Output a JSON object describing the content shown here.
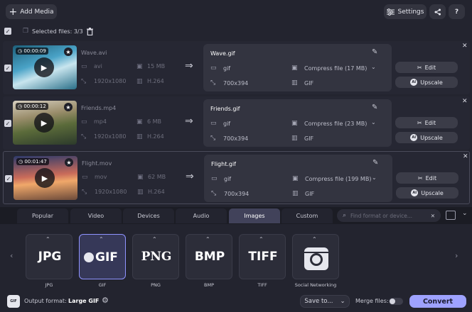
{
  "toolbar": {
    "add_media_label": "Add Media",
    "settings_label": "Settings"
  },
  "selection": {
    "selected_label": "Selected files: 3/3"
  },
  "files": [
    {
      "duration": "00:00:09",
      "name": "Wave.avi",
      "container": "avi",
      "size": "15 MB",
      "resolution": "1920x1080",
      "codec": "H.264",
      "output_name": "Wave.gif",
      "output_format": "gif",
      "compress": "Compress file (17 MB)",
      "output_resolution": "700x394",
      "output_codec": "GIF"
    },
    {
      "duration": "00:00:12",
      "name": "Friends.mp4",
      "container": "mp4",
      "size": "6 MB",
      "resolution": "1920x1080",
      "codec": "H.264",
      "output_name": "Friends.gif",
      "output_format": "gif",
      "compress": "Compress file (23 MB)",
      "output_resolution": "700x394",
      "output_codec": "GIF"
    },
    {
      "duration": "00:01:47",
      "name": "Flight.mov",
      "container": "mov",
      "size": "62 MB",
      "resolution": "1920x1080",
      "codec": "H.264",
      "output_name": "Flight.gif",
      "output_format": "gif",
      "compress": "Compress file (199 MB)",
      "output_resolution": "700x394",
      "output_codec": "GIF"
    }
  ],
  "row_actions": {
    "edit_label": "Edit",
    "upscale_label": "Upscale",
    "ai_badge": "AI"
  },
  "tabs": [
    "Popular",
    "Video",
    "Devices",
    "Audio",
    "Images",
    "Custom"
  ],
  "active_tab": "Images",
  "search": {
    "placeholder": "Find format or device..."
  },
  "formats": [
    {
      "logo": "JPG",
      "label": "JPG"
    },
    {
      "logo": "GIF",
      "label": "GIF"
    },
    {
      "logo": "PNG",
      "label": "PNG"
    },
    {
      "logo": "BMP",
      "label": "BMP"
    },
    {
      "logo": "TIFF",
      "label": "TIFF"
    },
    {
      "logo": "",
      "label": "Social Networking"
    }
  ],
  "bottom": {
    "output_format_label": "Output format:",
    "output_format_value": "Large GIF",
    "format_icon_text": "GIF",
    "save_to_label": "Save to...",
    "merge_label": "Merge files:",
    "convert_label": "Convert"
  },
  "colors": {
    "background": "#23242f",
    "accent": "#9ea2ff",
    "active_tab": "#41425a"
  }
}
